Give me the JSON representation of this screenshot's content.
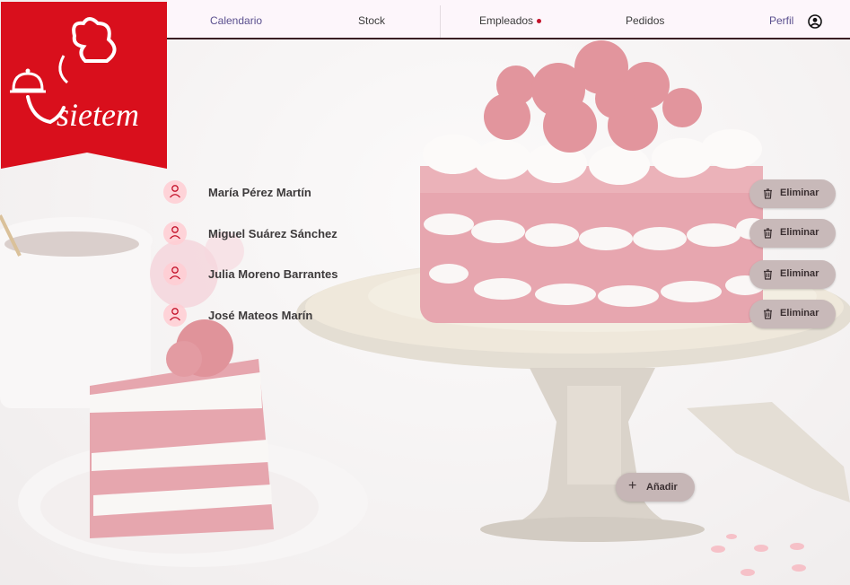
{
  "brand": {
    "name": "sietem",
    "color": "#d90f1c"
  },
  "nav": {
    "items": [
      {
        "label": "Calendario"
      },
      {
        "label": "Stock"
      },
      {
        "label": "Empleados"
      },
      {
        "label": "Pedidos"
      },
      {
        "label": "Perfil"
      }
    ],
    "active": "Calendario",
    "notification_on": "Empleados",
    "profile_icon": "account-circle-icon"
  },
  "employees": [
    {
      "name": "María Pérez Martín",
      "delete_label": "Eliminar"
    },
    {
      "name": "Miguel Suárez Sánchez",
      "delete_label": "Eliminar"
    },
    {
      "name": "Julia Moreno Barrantes",
      "delete_label": "Eliminar"
    },
    {
      "name": "José Mateos Marín",
      "delete_label": "Eliminar"
    }
  ],
  "add_button": {
    "label": "Añadir",
    "icon": "plus-icon"
  },
  "colors": {
    "accent": "#c4122a",
    "button_bg": "#c8b9b9",
    "nav_bg": "#fdf6fb"
  }
}
